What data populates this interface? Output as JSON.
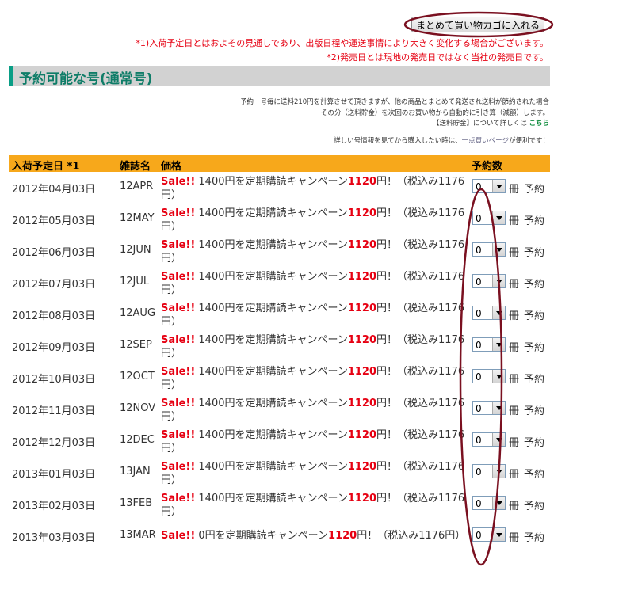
{
  "cart_button": "まとめて買い物カゴに入れる",
  "notes": [
    "*1)入荷予定日とはおよその見通しであり、出版日程や運送事情により大きく変化する場合がございます。",
    "*2)発売日とは現地の発売日ではなく当社の発売日です。"
  ],
  "section_title": "予約可能な号(通常号)",
  "info": {
    "line1": "予約一号毎に送料210円を計算させて頂きますが、他の商品とまとめて発送され送料が節約された場合",
    "line2": "その分（送料貯金）を次回のお買い物から自動的に引き算（減額）します。",
    "line3_prefix": "【送料貯金】について詳しくは",
    "line3_link": "こちら",
    "line4_prefix": "詳しい号情報を見てから購入したい時は、",
    "line4_link": "一点買いページ",
    "line4_suffix": "が便利です！"
  },
  "table": {
    "headers": {
      "date": "入荷予定日 *1",
      "magazine": "雑誌名",
      "price": "価格",
      "qty": "予約数"
    },
    "sale_label": "Sale!!",
    "unit_label": "冊",
    "reserve_label": "予約",
    "rows": [
      {
        "date": "2012年04月03日",
        "magazine": "12APR",
        "price_pre": "1400円を定期購読キャンペーン",
        "campaign_price": "1120",
        "price_post": "円！（税込み1176円）",
        "qty": "0"
      },
      {
        "date": "2012年05月03日",
        "magazine": "12MAY",
        "price_pre": "1400円を定期購読キャンペーン",
        "campaign_price": "1120",
        "price_post": "円！（税込み1176円）",
        "qty": "0"
      },
      {
        "date": "2012年06月03日",
        "magazine": "12JUN",
        "price_pre": "1400円を定期購読キャンペーン",
        "campaign_price": "1120",
        "price_post": "円！（税込み1176円）",
        "qty": "0"
      },
      {
        "date": "2012年07月03日",
        "magazine": "12JUL",
        "price_pre": "1400円を定期購読キャンペーン",
        "campaign_price": "1120",
        "price_post": "円！（税込み1176円）",
        "qty": "0"
      },
      {
        "date": "2012年08月03日",
        "magazine": "12AUG",
        "price_pre": "1400円を定期購読キャンペーン",
        "campaign_price": "1120",
        "price_post": "円！（税込み1176円）",
        "qty": "0"
      },
      {
        "date": "2012年09月03日",
        "magazine": "12SEP",
        "price_pre": "1400円を定期購読キャンペーン",
        "campaign_price": "1120",
        "price_post": "円！（税込み1176円）",
        "qty": "0"
      },
      {
        "date": "2012年10月03日",
        "magazine": "12OCT",
        "price_pre": "1400円を定期購読キャンペーン",
        "campaign_price": "1120",
        "price_post": "円！（税込み1176円）",
        "qty": "0"
      },
      {
        "date": "2012年11月03日",
        "magazine": "12NOV",
        "price_pre": "1400円を定期購読キャンペーン",
        "campaign_price": "1120",
        "price_post": "円！（税込み1176円）",
        "qty": "0"
      },
      {
        "date": "2012年12月03日",
        "magazine": "12DEC",
        "price_pre": "1400円を定期購読キャンペーン",
        "campaign_price": "1120",
        "price_post": "円！（税込み1176円）",
        "qty": "0"
      },
      {
        "date": "2013年01月03日",
        "magazine": "13JAN",
        "price_pre": "1400円を定期購読キャンペーン",
        "campaign_price": "1120",
        "price_post": "円！（税込み1176円）",
        "qty": "0"
      },
      {
        "date": "2013年02月03日",
        "magazine": "13FEB",
        "price_pre": "1400円を定期購読キャンペーン",
        "campaign_price": "1120",
        "price_post": "円！（税込み1176円）",
        "qty": "0"
      },
      {
        "date": "2013年03月03日",
        "magazine": "13MAR",
        "price_pre": "0円を定期購読キャンペーン",
        "campaign_price": "1120",
        "price_post": "円！（税込み1176円）",
        "qty": "0"
      }
    ]
  },
  "colors": {
    "accent_green": "#0f7d68",
    "header_orange": "#f7a81b",
    "sale_red": "#e60012",
    "annotation_maroon": "#7a1020"
  }
}
